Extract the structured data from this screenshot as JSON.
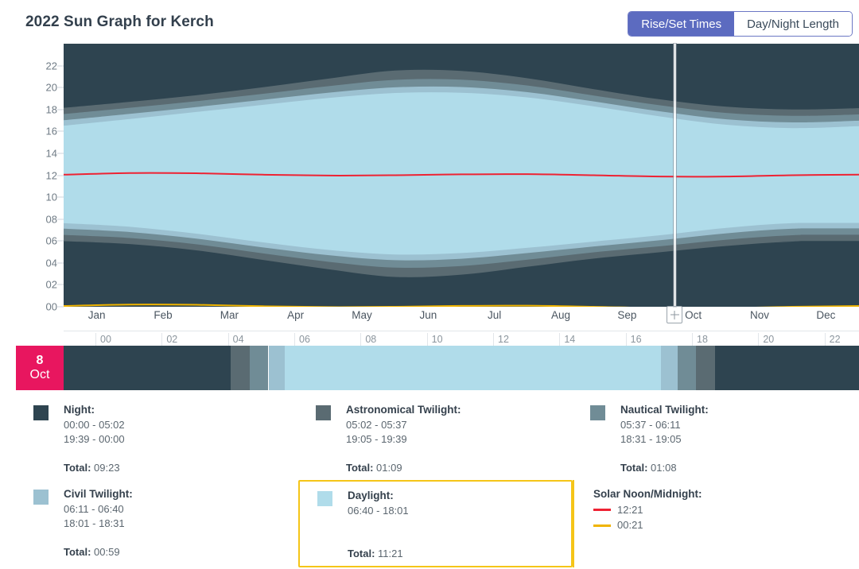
{
  "header": {
    "title": "2022 Sun Graph for Kerch",
    "toggle": {
      "options": [
        {
          "label": "Rise/Set Times",
          "active": true
        },
        {
          "label": "Day/Night Length",
          "active": false
        }
      ]
    }
  },
  "colors": {
    "night": "#2e4450",
    "astronomical": "#5a6b72",
    "nautical": "#708c96",
    "civil": "#9cc1d1",
    "daylight": "#b0dcea",
    "solar_noon_line": "#ee2233",
    "solar_midnight_line": "#f0b400",
    "highlight_border": "#f5c518",
    "date_badge": "#e8165f",
    "accent": "#5c6bc0"
  },
  "chart_data": {
    "type": "area",
    "title": "2022 Sun Graph for Kerch",
    "xlabel": "",
    "ylabel": "",
    "ylim": [
      0,
      24
    ],
    "ytick_labels": [
      "00",
      "02",
      "04",
      "06",
      "08",
      "10",
      "12",
      "14",
      "16",
      "18",
      "20",
      "22"
    ],
    "xtick_labels": [
      "Jan",
      "Feb",
      "Mar",
      "Apr",
      "May",
      "Jun",
      "Jul",
      "Aug",
      "Sep",
      "Oct",
      "Nov",
      "Dec"
    ],
    "hour_axis_labels": [
      "00",
      "02",
      "04",
      "06",
      "08",
      "10",
      "12",
      "14",
      "16",
      "18",
      "20",
      "22"
    ],
    "grid": false,
    "legend_position": "below",
    "cursor": {
      "label": "Oct",
      "day": 8,
      "x_fraction": 0.768
    },
    "series": [
      {
        "name": "Daylight",
        "x_months": [
          "Jan",
          "Feb",
          "Mar",
          "Apr",
          "May",
          "Jun",
          "Jul",
          "Aug",
          "Sep",
          "Oct",
          "Nov",
          "Dec",
          "Jan"
        ],
        "sunrise": [
          7.62,
          7.3,
          6.67,
          5.88,
          5.18,
          4.77,
          4.9,
          5.38,
          5.95,
          6.53,
          7.2,
          7.63,
          7.65
        ],
        "sunset": [
          16.52,
          17.13,
          17.77,
          18.42,
          19.05,
          19.5,
          19.52,
          19.1,
          18.28,
          17.37,
          16.6,
          16.3,
          16.48
        ]
      },
      {
        "name": "Civil Twilight",
        "start": [
          7.12,
          6.82,
          6.22,
          5.42,
          4.7,
          4.25,
          4.38,
          4.9,
          5.5,
          6.07,
          6.7,
          7.12,
          7.15
        ],
        "end": [
          17.02,
          17.6,
          18.22,
          18.88,
          19.53,
          20.02,
          20.05,
          19.58,
          18.73,
          17.83,
          17.1,
          16.82,
          16.98
        ]
      },
      {
        "name": "Nautical Twilight",
        "start": [
          6.55,
          6.27,
          5.7,
          4.88,
          4.1,
          3.57,
          3.72,
          4.3,
          4.97,
          5.52,
          6.12,
          6.53,
          6.57
        ],
        "end": [
          17.58,
          18.15,
          18.75,
          19.42,
          20.13,
          20.7,
          20.72,
          20.18,
          19.27,
          18.38,
          17.68,
          17.42,
          17.55
        ]
      },
      {
        "name": "Astronomical Twilight",
        "start": [
          5.98,
          5.72,
          5.15,
          4.28,
          3.42,
          2.72,
          2.93,
          3.65,
          4.4,
          4.98,
          5.55,
          5.95,
          6.0
        ],
        "end": [
          18.15,
          18.7,
          19.3,
          20.02,
          20.82,
          21.55,
          21.52,
          20.85,
          19.85,
          18.92,
          18.25,
          18.0,
          18.12
        ]
      },
      {
        "name": "Solar Noon",
        "values": [
          12.05,
          12.2,
          12.18,
          12.05,
          11.97,
          12.0,
          12.08,
          12.1,
          12.0,
          11.88,
          11.88,
          12.0,
          12.05
        ],
        "line_color": "#ee2233"
      },
      {
        "name": "Solar Midnight",
        "values": [
          0.07,
          0.2,
          0.18,
          0.05,
          23.97,
          0.0,
          0.08,
          0.1,
          0.0,
          23.88,
          23.88,
          0.0,
          0.07
        ],
        "line_color": "#f0b400"
      }
    ]
  },
  "day_bar": {
    "date_day": "8",
    "date_month": "Oct",
    "segments": [
      {
        "name": "night",
        "start_hour": 0.0,
        "end_hour": 5.03,
        "color": "#2e4450"
      },
      {
        "name": "astronomical-twilight",
        "start_hour": 5.03,
        "end_hour": 5.62,
        "color": "#5a6b72"
      },
      {
        "name": "nautical-twilight",
        "start_hour": 5.62,
        "end_hour": 6.18,
        "color": "#708c96"
      },
      {
        "name": "civil-twilight",
        "start_hour": 6.18,
        "end_hour": 6.67,
        "color": "#9cc1d1"
      },
      {
        "name": "daylight",
        "start_hour": 6.67,
        "end_hour": 18.02,
        "color": "#b0dcea"
      },
      {
        "name": "civil-twilight",
        "start_hour": 18.02,
        "end_hour": 18.52,
        "color": "#9cc1d1"
      },
      {
        "name": "nautical-twilight",
        "start_hour": 18.52,
        "end_hour": 19.08,
        "color": "#708c96"
      },
      {
        "name": "astronomical-twilight",
        "start_hour": 19.08,
        "end_hour": 19.65,
        "color": "#5a6b72"
      },
      {
        "name": "night",
        "start_hour": 19.65,
        "end_hour": 24.0,
        "color": "#2e4450"
      }
    ]
  },
  "legend": {
    "items": [
      {
        "id": "night",
        "title": "Night:",
        "swatch": "#2e4450",
        "times": [
          "00:00 - 05:02",
          "19:39 - 00:00"
        ],
        "total_label": "Total:",
        "total_value": "09:23",
        "highlight": "none"
      },
      {
        "id": "astronomical-twilight",
        "title": "Astronomical Twilight:",
        "swatch": "#5a6b72",
        "times": [
          "05:02 - 05:37",
          "19:05 - 19:39"
        ],
        "total_label": "Total:",
        "total_value": "01:09",
        "highlight": "none"
      },
      {
        "id": "nautical-twilight",
        "title": "Nautical Twilight:",
        "swatch": "#708c96",
        "times": [
          "05:37 - 06:11",
          "18:31 - 19:05"
        ],
        "total_label": "Total:",
        "total_value": "01:08",
        "highlight": "none"
      },
      {
        "id": "civil-twilight",
        "title": "Civil Twilight:",
        "swatch": "#9cc1d1",
        "times": [
          "06:11 - 06:40",
          "18:01 - 18:31"
        ],
        "total_label": "Total:",
        "total_value": "00:59",
        "highlight": "none"
      },
      {
        "id": "daylight",
        "title": "Daylight:",
        "swatch": "#b0dcea",
        "times": [
          "06:40 - 18:01"
        ],
        "total_label": "Total:",
        "total_value": "11:21",
        "highlight": "box"
      }
    ],
    "solar": {
      "title": "Solar Noon/Midnight:",
      "rows": [
        {
          "color": "#ee2233",
          "value": "12:21"
        },
        {
          "color": "#f0b400",
          "value": "00:21"
        }
      ],
      "highlight": "left"
    }
  }
}
